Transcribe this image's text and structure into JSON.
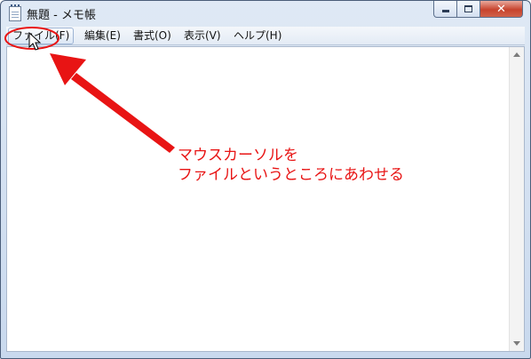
{
  "window": {
    "title": "無題 - メモ帳",
    "icon": "notepad-icon",
    "controls": {
      "minimize": "minimize-icon",
      "maximize": "maximize-icon",
      "close": "✕"
    }
  },
  "menu": {
    "items": [
      {
        "label": "ファイル(F)"
      },
      {
        "label": "編集(E)"
      },
      {
        "label": "書式(O)"
      },
      {
        "label": "表示(V)"
      },
      {
        "label": "ヘルプ(H)"
      }
    ]
  },
  "editor": {
    "content": ""
  },
  "annotation": {
    "line1": "マウスカーソルを",
    "line2": "ファイルというところにあわせる",
    "color": "#e81414"
  }
}
